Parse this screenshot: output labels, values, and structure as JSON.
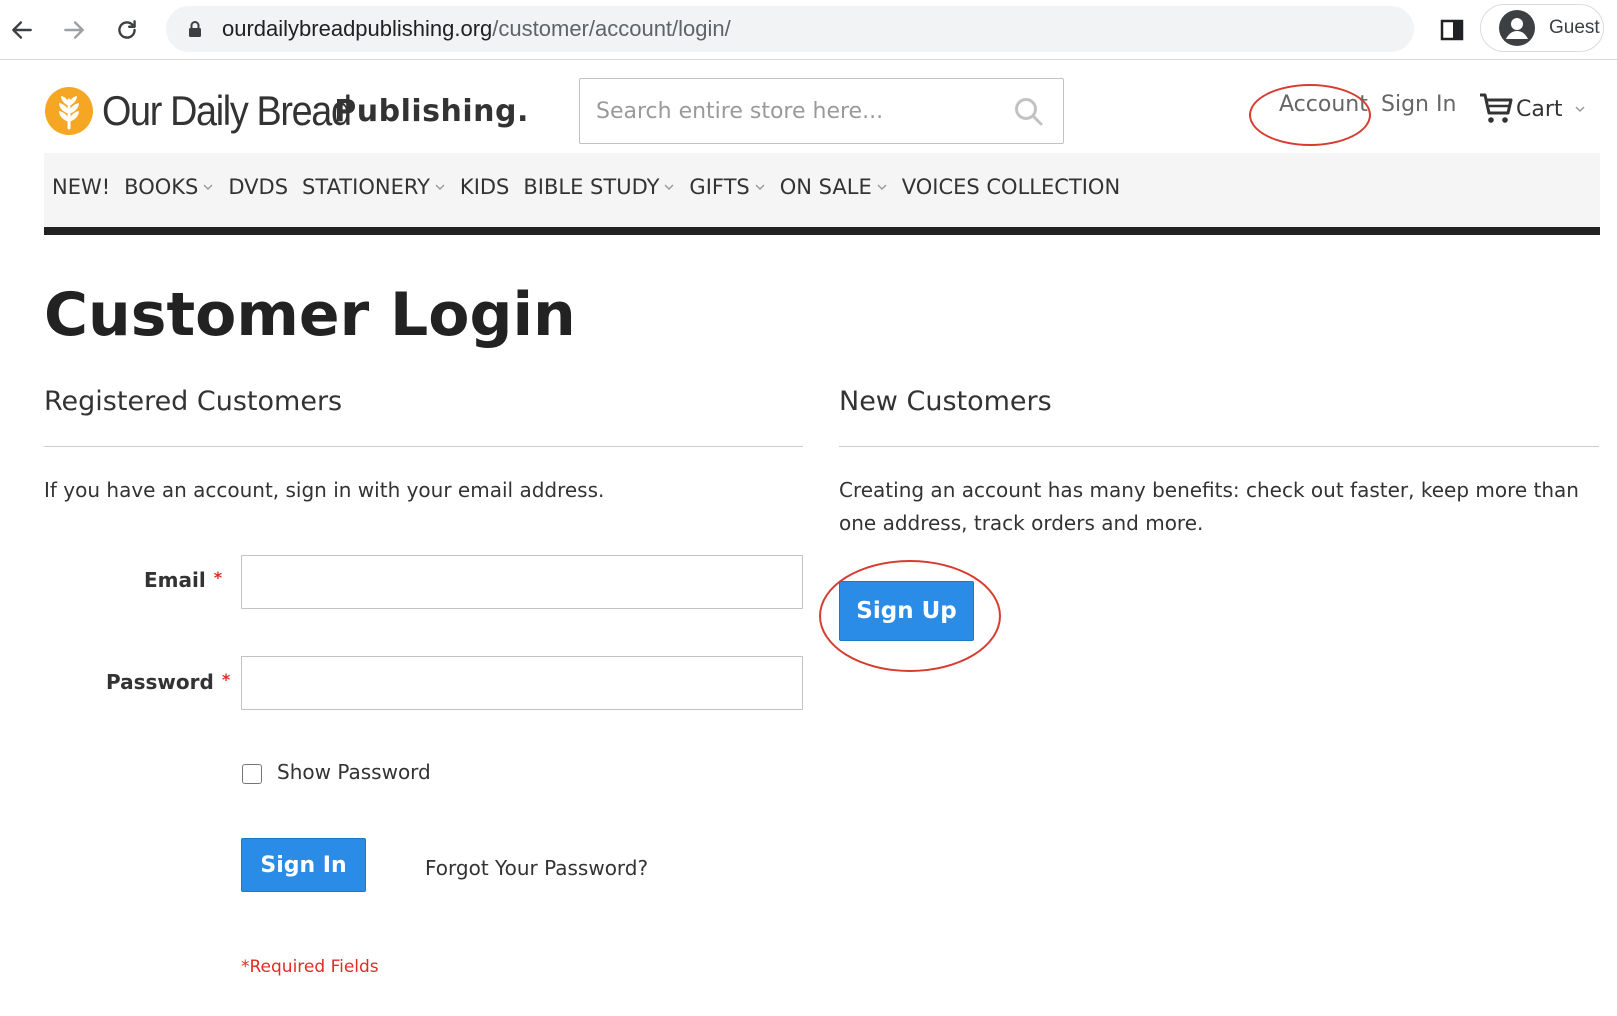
{
  "browser": {
    "url_domain": "ourdailybreadpublishing.org",
    "url_path": "/customer/account/login/",
    "profile_label": "Guest"
  },
  "header": {
    "brand_name": "Our Daily Bread",
    "brand_sub": "Publishing.",
    "search_placeholder": "Search entire store here...",
    "account_label": "Account",
    "sign_in_label": "Sign In",
    "cart_label": "Cart"
  },
  "nav": {
    "items": [
      {
        "label": "NEW!",
        "dropdown": false
      },
      {
        "label": "BOOKS",
        "dropdown": true
      },
      {
        "label": "DVDS",
        "dropdown": false
      },
      {
        "label": "STATIONERY",
        "dropdown": true
      },
      {
        "label": "KIDS",
        "dropdown": false
      },
      {
        "label": "BIBLE STUDY",
        "dropdown": true
      },
      {
        "label": "GIFTS",
        "dropdown": true
      },
      {
        "label": "ON SALE",
        "dropdown": true
      },
      {
        "label": "VOICES COLLECTION",
        "dropdown": false
      }
    ]
  },
  "page": {
    "title": "Customer Login",
    "registered": {
      "heading": "Registered Customers",
      "intro": "If you have an account, sign in with your email address.",
      "email_label": "Email",
      "email_value": "",
      "password_label": "Password",
      "password_value": "",
      "required_mark": "*",
      "show_password_label": "Show Password",
      "show_password_checked": false,
      "sign_in_button": "Sign In",
      "forgot_link": "Forgot Your Password?",
      "required_note": "Required Fields"
    },
    "new_customers": {
      "heading": "New Customers",
      "intro": "Creating an account has many benefits: check out faster, keep more than one address, track orders and more.",
      "sign_up_button": "Sign Up"
    }
  },
  "colors": {
    "accent_blue": "#2b8ce8",
    "annotation_red": "#d63c2f",
    "required_red": "#e02b27",
    "nav_bar_bottom": "#222222",
    "logo_orange": "#f5a623"
  },
  "icons": [
    "back-arrow-icon",
    "forward-arrow-icon",
    "reload-icon",
    "lock-icon",
    "side-panel-icon",
    "profile-avatar-icon",
    "search-icon",
    "cart-icon",
    "chevron-down-icon",
    "wheat-logo-icon"
  ]
}
